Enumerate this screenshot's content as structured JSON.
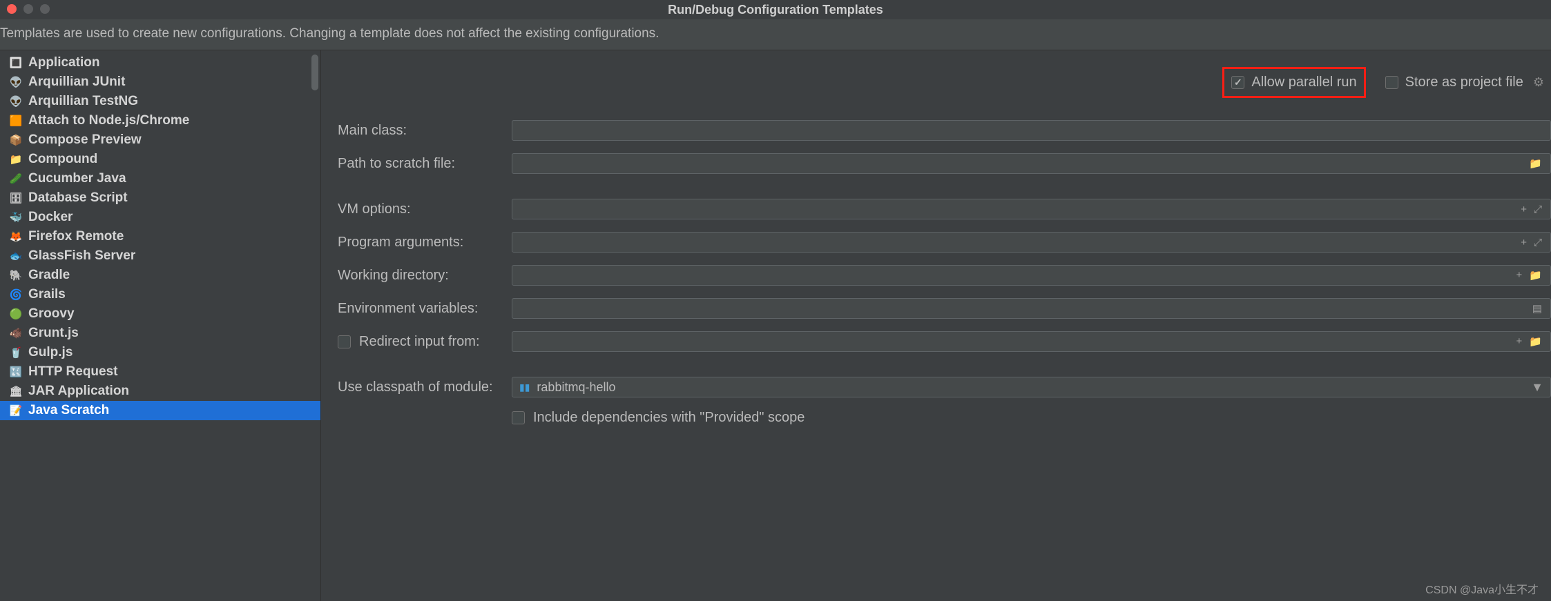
{
  "title": "Run/Debug Configuration Templates",
  "info": "Templates are used to create new configurations. Changing a template does not affect the existing configurations.",
  "sidebar": {
    "items": [
      {
        "label": "Application",
        "icon": "🔳"
      },
      {
        "label": "Arquillian JUnit",
        "icon": "👽"
      },
      {
        "label": "Arquillian TestNG",
        "icon": "👽"
      },
      {
        "label": "Attach to Node.js/Chrome",
        "icon": "🟧"
      },
      {
        "label": "Compose Preview",
        "icon": "📦"
      },
      {
        "label": "Compound",
        "icon": "📁"
      },
      {
        "label": "Cucumber Java",
        "icon": "🥒"
      },
      {
        "label": "Database Script",
        "icon": "🗄"
      },
      {
        "label": "Docker",
        "icon": "🐳"
      },
      {
        "label": "Firefox Remote",
        "icon": "🦊"
      },
      {
        "label": "GlassFish Server",
        "icon": "🐟"
      },
      {
        "label": "Gradle",
        "icon": "🐘"
      },
      {
        "label": "Grails",
        "icon": "🌀"
      },
      {
        "label": "Groovy",
        "icon": "🟢"
      },
      {
        "label": "Grunt.js",
        "icon": "🐗"
      },
      {
        "label": "Gulp.js",
        "icon": "🥤"
      },
      {
        "label": "HTTP Request",
        "icon": "🔣"
      },
      {
        "label": "JAR Application",
        "icon": "🏛"
      },
      {
        "label": "Java Scratch",
        "icon": "📝"
      }
    ],
    "selectedIndex": 18
  },
  "topOptions": {
    "allowParallel": {
      "label": "Allow parallel run",
      "checked": true
    },
    "storeProject": {
      "label": "Store as project file",
      "checked": false
    }
  },
  "form": {
    "mainClass": {
      "label": "Main class:",
      "value": ""
    },
    "scratchPath": {
      "label": "Path to scratch file:",
      "value": ""
    },
    "vmOptions": {
      "label": "VM options:",
      "value": ""
    },
    "programArgs": {
      "label": "Program arguments:",
      "value": ""
    },
    "workingDir": {
      "label": "Working directory:",
      "value": ""
    },
    "envVars": {
      "label": "Environment variables:",
      "value": ""
    },
    "redirectInput": {
      "label": "Redirect input from:",
      "checked": false,
      "value": ""
    },
    "classpath": {
      "label": "Use classpath of module:",
      "value": "rabbitmq-hello"
    },
    "includeProvided": {
      "label": "Include dependencies with \"Provided\" scope",
      "checked": false
    }
  },
  "watermark": "CSDN @Java小生不才"
}
